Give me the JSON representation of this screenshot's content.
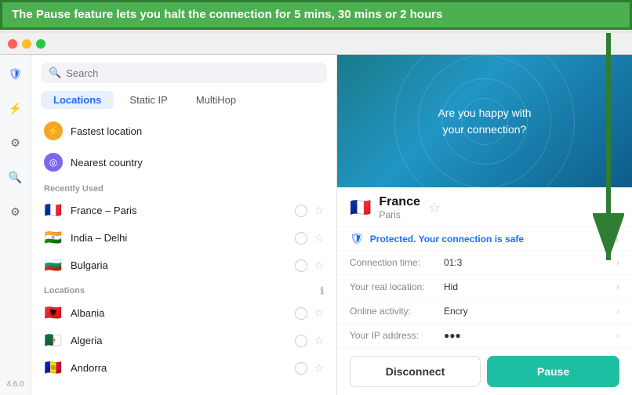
{
  "banner": {
    "text": "The Pause feature lets you halt the connection for 5 mins, 30 mins or 2 hours"
  },
  "window": {
    "version": "4.6.0"
  },
  "sidebar": {
    "icons": [
      {
        "name": "shield-icon",
        "symbol": "🛡"
      },
      {
        "name": "bolt-icon",
        "symbol": "⚡"
      },
      {
        "name": "settings-icon",
        "symbol": "⚙"
      },
      {
        "name": "search-icon-nav",
        "symbol": "🔍"
      },
      {
        "name": "settings2-icon",
        "symbol": "⚙"
      }
    ]
  },
  "search": {
    "placeholder": "Search"
  },
  "tabs": [
    {
      "label": "Locations",
      "active": true
    },
    {
      "label": "Static IP",
      "active": false
    },
    {
      "label": "MultiHop",
      "active": false
    }
  ],
  "special_locations": [
    {
      "icon": "⚡",
      "icon_type": "lightning",
      "label": "Fastest location"
    },
    {
      "icon": "◎",
      "icon_type": "target",
      "label": "Nearest country"
    }
  ],
  "recently_used_header": "Recently Used",
  "recently_used": [
    {
      "flag": "🇫🇷",
      "name": "France – Paris"
    },
    {
      "flag": "🇮🇳",
      "name": "India – Delhi"
    },
    {
      "flag": "🇧🇬",
      "name": "Bulgaria"
    }
  ],
  "locations_header": "Locations",
  "locations": [
    {
      "flag": "🇦🇱",
      "name": "Albania"
    },
    {
      "flag": "🇩🇿",
      "name": "Algeria"
    },
    {
      "flag": "🇦🇩",
      "name": "Andorra"
    }
  ],
  "right_panel": {
    "map_text_line1": "Are you happy with",
    "map_text_line2": "your connection?",
    "country": "France",
    "city": "Paris",
    "status": "Protected. Your connection is safe",
    "stats": [
      {
        "label": "Connection time:",
        "value": "01:3"
      },
      {
        "label": "Your real location:",
        "value": "Hid"
      },
      {
        "label": "Online activity:",
        "value": "Encry"
      },
      {
        "label": "Your IP address:",
        "value": "●●●"
      }
    ],
    "btn_disconnect": "Disconnect",
    "btn_pause": "Pause"
  }
}
